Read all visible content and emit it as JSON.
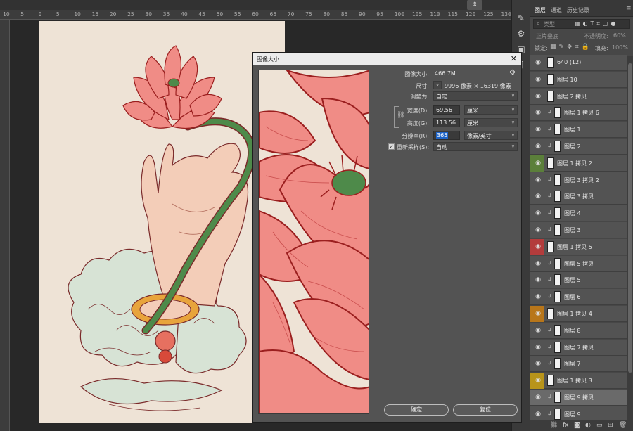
{
  "ruler": {
    "ticks": [
      "10",
      "5",
      "0",
      "5",
      "10",
      "15",
      "20",
      "25",
      "30",
      "35",
      "40",
      "45",
      "50",
      "55",
      "60",
      "65",
      "70",
      "75",
      "80",
      "85",
      "90",
      "95",
      "100",
      "105",
      "110",
      "115",
      "120",
      "125",
      "130"
    ]
  },
  "panel": {
    "tabs": [
      "图层",
      "通道",
      "历史记录"
    ],
    "search_placeholder": "类型",
    "blend_mode": "正片叠底",
    "opacity_label": "不透明度:",
    "opacity_value": "60%",
    "lock_label": "锁定:",
    "fill_label": "填充:",
    "fill_value": "100%",
    "layers": [
      {
        "name": "640 (12)",
        "eye_color": "",
        "clip": false
      },
      {
        "name": "图层 10",
        "eye_color": "",
        "clip": false
      },
      {
        "name": "图层 2 拷贝",
        "eye_color": "",
        "clip": false
      },
      {
        "name": "图层 1 拷贝 6",
        "eye_color": "",
        "clip": true
      },
      {
        "name": "图层 1",
        "eye_color": "",
        "clip": true
      },
      {
        "name": "图层 2",
        "eye_color": "",
        "clip": true
      },
      {
        "name": "图层 1 拷贝 2",
        "eye_color": "#5b7f3a",
        "clip": false
      },
      {
        "name": "图层 3 拷贝 2",
        "eye_color": "",
        "clip": true
      },
      {
        "name": "图层 3 拷贝",
        "eye_color": "",
        "clip": true
      },
      {
        "name": "图层 4",
        "eye_color": "",
        "clip": true
      },
      {
        "name": "图层 3",
        "eye_color": "",
        "clip": true
      },
      {
        "name": "图层 1 拷贝 5",
        "eye_color": "#b33c3c",
        "clip": false
      },
      {
        "name": "图层 5 拷贝",
        "eye_color": "",
        "clip": true
      },
      {
        "name": "图层 5",
        "eye_color": "",
        "clip": true
      },
      {
        "name": "图层 6",
        "eye_color": "",
        "clip": true
      },
      {
        "name": "图层 1 拷贝 4",
        "eye_color": "#b8761a",
        "clip": false
      },
      {
        "name": "图层 8",
        "eye_color": "",
        "clip": true
      },
      {
        "name": "图层 7 拷贝",
        "eye_color": "",
        "clip": true
      },
      {
        "name": "图层 7",
        "eye_color": "",
        "clip": true
      },
      {
        "name": "图层 1 拷贝 3",
        "eye_color": "#b8941a",
        "clip": false
      },
      {
        "name": "图层 9 拷贝",
        "eye_color": "",
        "clip": true
      },
      {
        "name": "图层 9",
        "eye_color": "",
        "clip": true
      }
    ],
    "footer_icons": [
      "link-icon",
      "fx-icon",
      "mask-icon",
      "adjustment-icon",
      "folder-icon",
      "new-layer-icon",
      "trash-icon"
    ]
  },
  "dialog": {
    "title": "图像大小",
    "close_glyph": "✕",
    "image_size_label": "图像大小:",
    "image_size_value": "466.7M",
    "dimensions_label": "尺寸:",
    "dimensions_value": "9996 像素  ×  16319 像素",
    "fit_to_label": "调整为:",
    "fit_to_value": "自定",
    "width_label": "宽度(D):",
    "width_value": "69.56",
    "width_unit": "厘米",
    "height_label": "高度(G):",
    "height_value": "113.56",
    "height_unit": "厘米",
    "resolution_label": "分辨率(R):",
    "resolution_value": "365",
    "resolution_unit": "像素/英寸",
    "resample_label": "重新采样(S):",
    "resample_value": "自动",
    "resample_checked": true,
    "ok_label": "确定",
    "reset_label": "复位"
  },
  "colors": {
    "canvas_bg": "#eee3d6",
    "lotus_pink": "#f08c86",
    "lotus_outline": "#9b1f1f",
    "stem_green": "#4e8a4a",
    "cloud": "#d7e3d5",
    "skin": "#f3cdb8",
    "bracelet": "#e8a43c"
  }
}
